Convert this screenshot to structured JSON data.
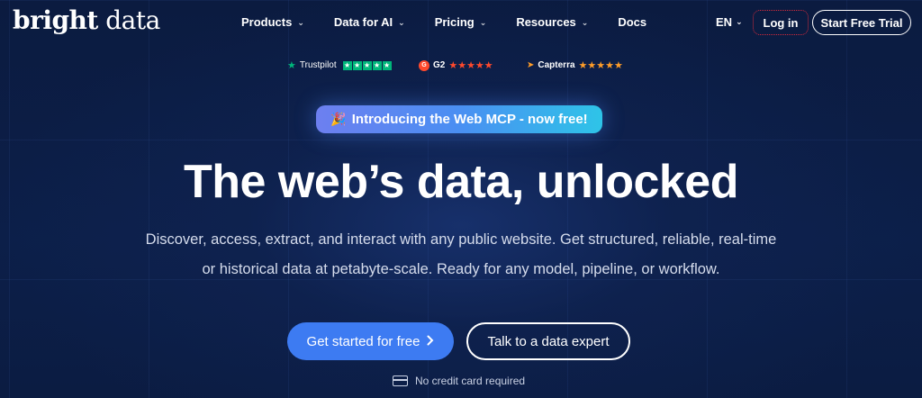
{
  "nav": {
    "logo_bold": "bright",
    "logo_light": " data",
    "menu": [
      {
        "label": "Products",
        "dropdown": true
      },
      {
        "label": "Data for AI",
        "dropdown": true
      },
      {
        "label": "Pricing",
        "dropdown": true
      },
      {
        "label": "Resources",
        "dropdown": true
      },
      {
        "label": "Docs",
        "dropdown": false
      }
    ],
    "language": "EN",
    "login_label": "Log in",
    "trial_label": "Start Free Trial"
  },
  "ratings": {
    "trustpilot": {
      "name": "Trustpilot",
      "stars": 5
    },
    "g2": {
      "name": "G2",
      "badge": "G",
      "stars": 4.5
    },
    "capterra": {
      "name": "Capterra",
      "stars": 5
    }
  },
  "announcement": {
    "icon": "party-popper-icon",
    "text": "Introducing the Web MCP - now free!"
  },
  "hero": {
    "title": "The web’s data, unlocked",
    "subtitle_line1": "Discover, access, extract, and interact with any public website. Get structured, reliable, real-time",
    "subtitle_line2": "or historical data at petabyte-scale. Ready for any model, pipeline, or workflow."
  },
  "cta": {
    "primary_label": "Get started for free",
    "primary_icon": "chevron-right-icon",
    "secondary_label": "Talk to a data expert",
    "note": "No credit card required",
    "note_icon": "credit-card-icon"
  },
  "colors": {
    "background": "#0a1a3d",
    "primary_button": "#3d7bf2",
    "trustpilot_green": "#00b67a",
    "g2_red": "#ff492c",
    "capterra_orange": "#ff9d28"
  }
}
